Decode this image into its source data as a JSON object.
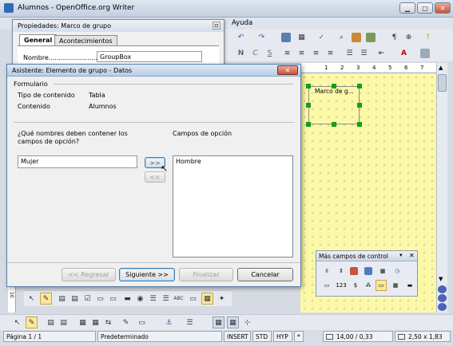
{
  "window": {
    "title": "Alumnos - OpenOffice.org Writer",
    "menu_visible": "Ayuda"
  },
  "props_dialog": {
    "title": "Propiedades: Marco de grupo",
    "tabs": [
      "General",
      "Acontecimientos"
    ],
    "name_label": "Nombre...............................",
    "name_value": "GroupBox"
  },
  "wizard": {
    "title": "Asistente: Elemento de grupo - Datos",
    "section": "Formulario",
    "content_type_label": "Tipo de contenido",
    "content_type_value": "Tabla",
    "content_label": "Contenido",
    "content_value": "Alumnos",
    "question": "¿Qué nombres deben contener los campos de opción?",
    "question_line1": "¿Qué nombres deben contener los",
    "question_line2": "campos de opción?",
    "input_value": "Mujer",
    "add_button": ">>",
    "remove_button": "<<",
    "options_label": "Campos de opción",
    "options": [
      "Hombre"
    ],
    "back_button": "<< Regresar",
    "next_button": "Siguiente >>",
    "finish_button": "Finalizar",
    "cancel_button": "Cancelar"
  },
  "document": {
    "group_box_label": "Marco de g..."
  },
  "more_controls": {
    "title": "Más campos de control",
    "numeric_label": "123"
  },
  "ruler": {
    "numbers": [
      "1",
      "2",
      "3",
      "4",
      "5",
      "6",
      "7"
    ],
    "vertical_label": "10"
  },
  "statusbar": {
    "page": "Página  1 / 1",
    "style": "Predeterminado",
    "mode": "INSERT",
    "selection": "STD",
    "hyperlink": "HYP",
    "modified": "*",
    "position": "14,00 / 0,33",
    "size": "2,50 x 1,83"
  }
}
